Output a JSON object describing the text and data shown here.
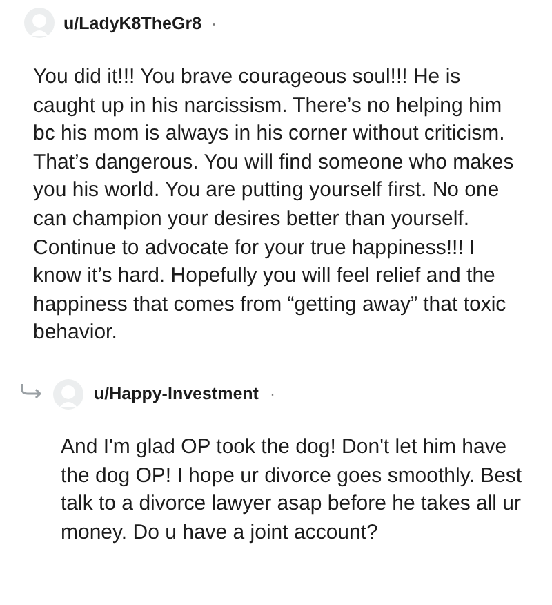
{
  "comments": [
    {
      "kind": "top",
      "username": "u/LadyK8TheGr8",
      "separator": "·",
      "body": "You did it!!! You brave courageous soul!!! He is caught up in his narcissism. There’s no helping him bc his mom is always in his corner without criticism. That’s dangerous. You will find someone who makes you his world. You are putting yourself first. No one can champion your desires better than yourself. Continue to advocate for your true happiness!!! I know it’s hard. Hopefully you will feel relief and the happiness that comes from “getting away” that toxic behavior."
    },
    {
      "kind": "reply",
      "username": "u/Happy-Investment",
      "separator": "·",
      "body": "And I'm glad OP took the dog! Don't let him have the dog OP! I hope ur divorce goes smoothly. Best talk to a divorce lawyer asap before he takes all ur money. Do u have a joint account?"
    }
  ]
}
